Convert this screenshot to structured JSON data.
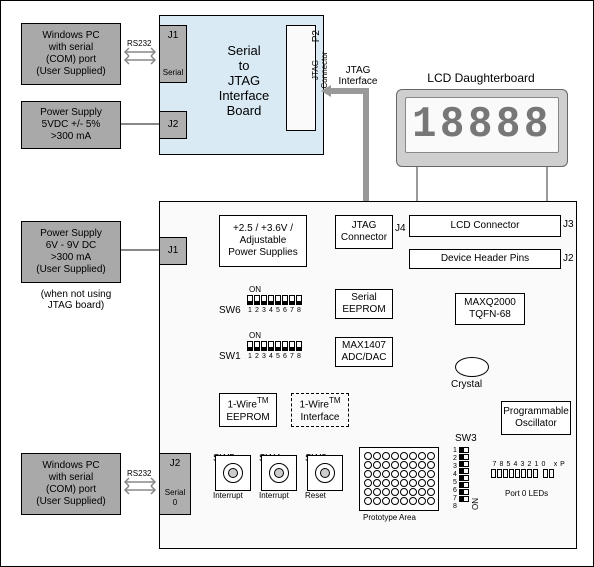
{
  "external": {
    "pc1": "Windows PC\nwith serial\n(COM) port\n(User Supplied)",
    "psu1": "Power Supply\n5VDC +/- 5%\n>300 mA",
    "psu2": "Power Supply\n6V - 9V DC\n>300 mA\n(User Supplied)",
    "psu2_note": "(when not using\nJTAG board)",
    "pc2": "Windows PC\nwith serial\n(COM) port\n(User Supplied)",
    "rs232": "RS232"
  },
  "jtag_board": {
    "title": "Serial\nto\nJTAG\nInterface\nBoard",
    "j1": "J1",
    "j1_sub": "Serial",
    "j2": "J2",
    "p2": "P2",
    "p2_sub": "JTAG\nConnector"
  },
  "interface": {
    "jtag_if": "JTAG\nInterface"
  },
  "lcd": {
    "title": "LCD Daughterboard",
    "digits": "18888",
    "connector": "LCD Connector",
    "j3": "J3"
  },
  "main": {
    "j1": "J1",
    "j2_hdr": "J2",
    "j2_serial": "J2",
    "serial0": "Serial\n0",
    "j4": "J4",
    "jtag_conn": "JTAG\nConnector",
    "psu_block": "+2.5 / +3.6V /\nAdjustable\nPower Supplies",
    "device_header": "Device Header Pins",
    "serial_eeprom": "Serial\nEEPROM",
    "max1407": "MAX1407\nADC/DAC",
    "maxq2000": "MAXQ2000\nTQFN-68",
    "crystal": "Crystal",
    "prog_osc": "Programmable\nOscillator",
    "onewire_eeprom_1": "1-Wire",
    "onewire_eeprom_2": "EEPROM",
    "onewire_if_1": "1-Wire",
    "onewire_if_2": "Interface",
    "tm": "TM",
    "sw6": "SW6",
    "sw1": "SW1",
    "sw5": "SW5",
    "sw4": "SW4",
    "sw2": "SW2",
    "sw3": "SW3",
    "on": "ON",
    "interrupt": "Interrupt",
    "reset": "Reset",
    "proto": "Prototype Area",
    "port0": "Port 0 LEDs",
    "dip_nums": [
      "1",
      "2",
      "3",
      "4",
      "5",
      "6",
      "7",
      "8"
    ],
    "sw3_nums": [
      "1",
      "2",
      "3",
      "4",
      "5",
      "6",
      "7",
      "8"
    ],
    "led_nums_a": [
      "7",
      "8",
      "5",
      "4",
      "3",
      "2",
      "1",
      "0"
    ],
    "led_nums_b": [
      "x",
      "P"
    ]
  }
}
